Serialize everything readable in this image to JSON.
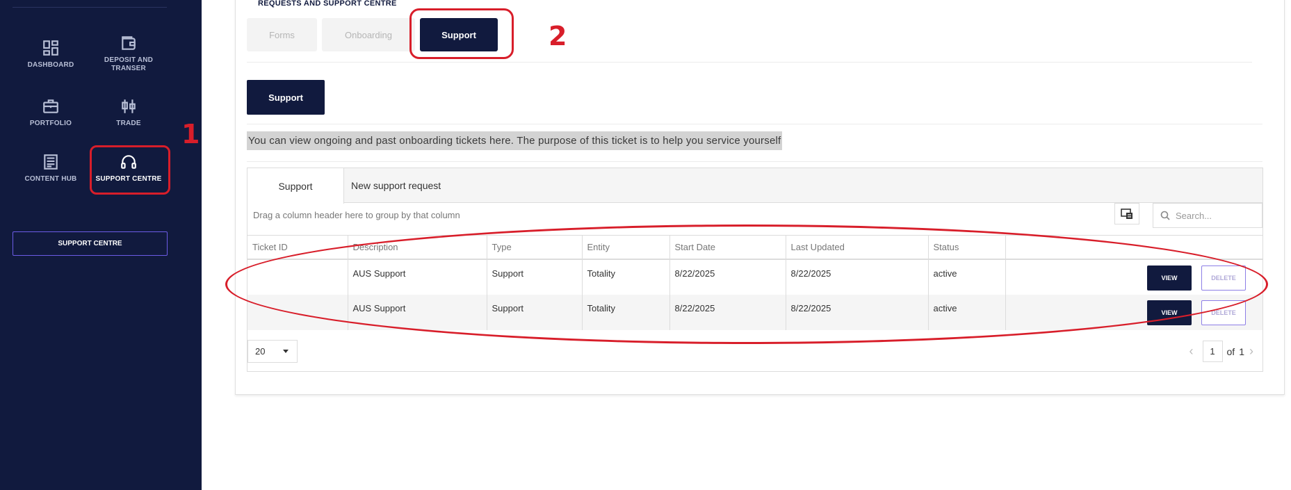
{
  "sidebar": {
    "items": [
      {
        "label": "DASHBOARD",
        "icon": "dashboard-icon"
      },
      {
        "label": "DEPOSIT AND TRANSER",
        "icon": "wallet-icon"
      },
      {
        "label": "PORTFOLIO",
        "icon": "briefcase-icon"
      },
      {
        "label": "TRADE",
        "icon": "candlestick-icon"
      },
      {
        "label": "CONTENT HUB",
        "icon": "newspaper-icon"
      },
      {
        "label": "SUPPORT CENTRE",
        "icon": "headset-icon"
      }
    ],
    "button_label": "SUPPORT CENTRE"
  },
  "annotations": {
    "step1": "1",
    "step2": "2",
    "color": "#d81e2a"
  },
  "main": {
    "heading": "REQUESTS AND SUPPORT CENTRE",
    "tabs": [
      {
        "label": "Forms",
        "active": false
      },
      {
        "label": "Onboarding",
        "active": false
      },
      {
        "label": "Support",
        "active": true
      }
    ],
    "support_button": "Support",
    "info_text": "You can view ongoing and past onboarding tickets here. The purpose of this ticket is to help you service yourself"
  },
  "grid": {
    "tabs": [
      "Support",
      "New support request"
    ],
    "group_panel": "Drag a column header here to group by that column",
    "search_placeholder": "Search...",
    "columns": [
      "Ticket ID",
      "Description",
      "Type",
      "Entity",
      "Start Date",
      "Last Updated",
      "Status",
      ""
    ],
    "rows": [
      {
        "ticket_id": "",
        "description": "AUS Support",
        "type": "Support",
        "entity": "Totality",
        "start_date": "8/22/2025",
        "last_updated": "8/22/2025",
        "status": "active"
      },
      {
        "ticket_id": "",
        "description": "AUS Support",
        "type": "Support",
        "entity": "Totality",
        "start_date": "8/22/2025",
        "last_updated": "8/22/2025",
        "status": "active"
      }
    ],
    "view_label": "VIEW",
    "delete_label": "DELETE",
    "page_size": "20",
    "pager": {
      "page": "1",
      "of_label": "of",
      "total": "1"
    }
  },
  "colors": {
    "navy": "#111a3e",
    "accent_purple": "#6c5ce7",
    "highlight": "#d3d3d3"
  }
}
